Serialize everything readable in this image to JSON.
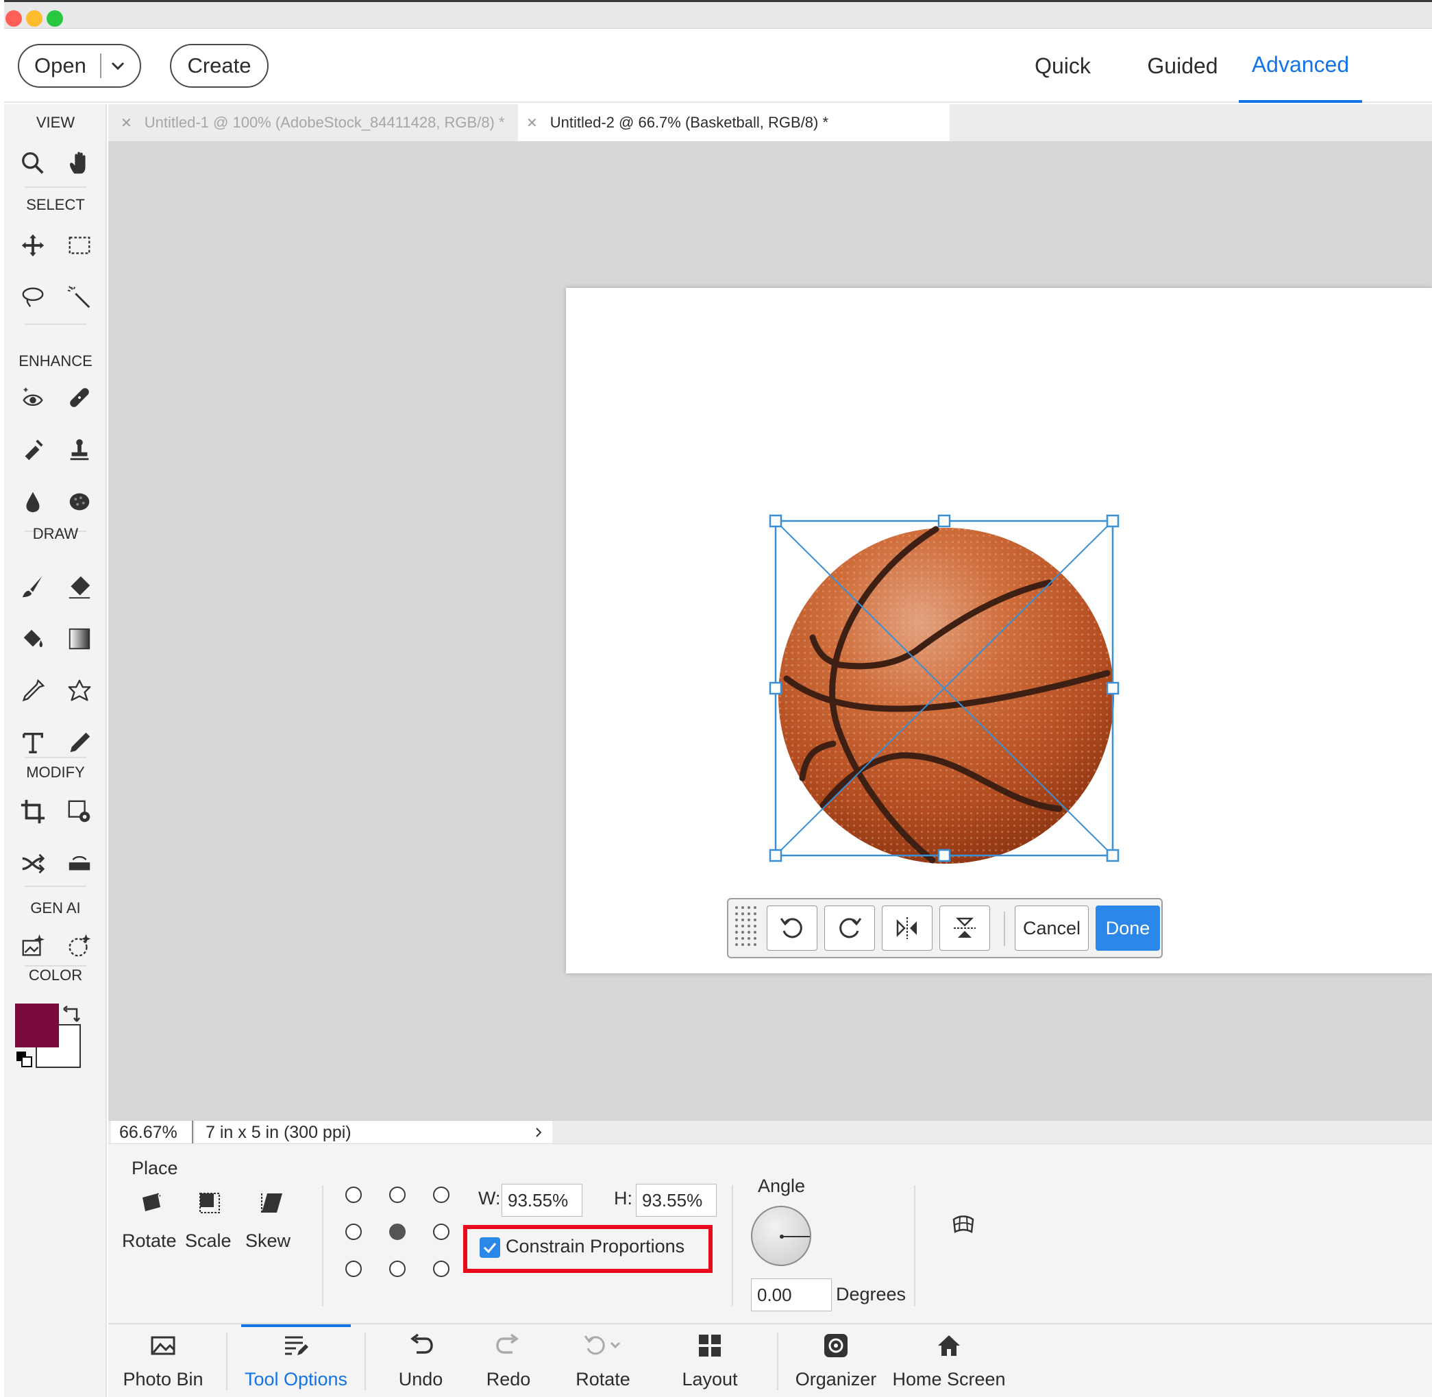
{
  "window": {
    "traffic_lights": [
      "#ff5f57",
      "#febc2e",
      "#28c840"
    ]
  },
  "topbar": {
    "open_label": "Open",
    "create_label": "Create",
    "modes": [
      "Quick",
      "Guided",
      "Advanced"
    ],
    "active_mode": "Advanced",
    "accent": "#1473e6"
  },
  "toolbar": {
    "sections": {
      "view": "VIEW",
      "select": "SELECT",
      "enhance": "ENHANCE",
      "draw": "DRAW",
      "modify": "MODIFY",
      "genai": "GEN AI",
      "color": "COLOR"
    },
    "foreground_color": "#7a0a3e",
    "background_color": "#ffffff"
  },
  "tabs": [
    {
      "title": "Untitled-1 @ 100% (AdobeStock_84411428, RGB/8) *",
      "active": false
    },
    {
      "title": "Untitled-2 @ 66.7% (Basketball, RGB/8) *",
      "active": true
    }
  ],
  "transform_bar": {
    "cancel_label": "Cancel",
    "done_label": "Done"
  },
  "status": {
    "zoom": "66.67%",
    "doc_size": "7 in x 5 in (300 ppi)"
  },
  "tool_options": {
    "title": "Place",
    "modes": [
      "Rotate",
      "Scale",
      "Skew"
    ],
    "width_label": "W:",
    "width_value": "93.55%",
    "height_label": "H:",
    "height_value": "93.55%",
    "constrain_label": "Constrain Proportions",
    "constrain_checked": true,
    "angle_label": "Angle",
    "angle_value": "0.00",
    "degrees_label": "Degrees"
  },
  "bottombar": {
    "items": [
      "Photo Bin",
      "Tool Options",
      "Undo",
      "Redo",
      "Rotate",
      "Layout",
      "Organizer",
      "Home Screen"
    ],
    "active": "Tool Options"
  }
}
